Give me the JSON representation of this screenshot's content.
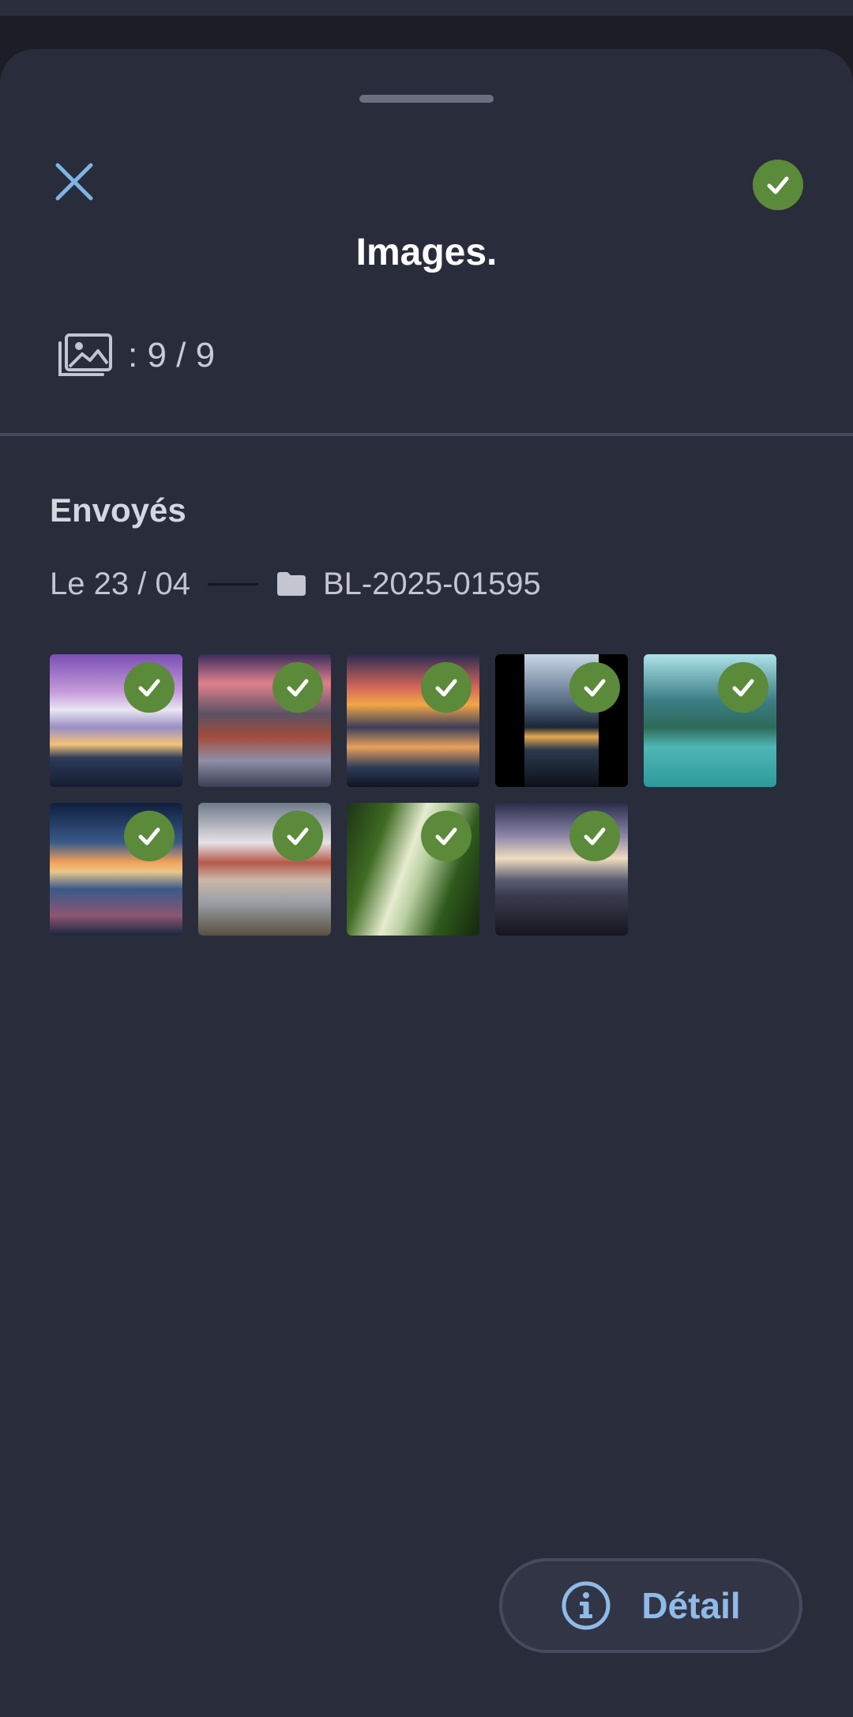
{
  "header": {
    "title": "Images.",
    "count": ": 9 / 9"
  },
  "section": {
    "title": "Envoyés",
    "date": "Le 23 / 04",
    "folder": "BL-2025-01595"
  },
  "images": [
    {
      "status": "sent"
    },
    {
      "status": "sent"
    },
    {
      "status": "sent"
    },
    {
      "status": "sent"
    },
    {
      "status": "sent"
    },
    {
      "status": "sent"
    },
    {
      "status": "sent"
    },
    {
      "status": "sent"
    },
    {
      "status": "sent"
    }
  ],
  "footer": {
    "detail_label": "Détail"
  },
  "colors": {
    "background": "#292c3b",
    "accent_blue": "#8fbbe8",
    "success_green": "#5b8a3a"
  },
  "icons": {
    "close": "close-icon",
    "status": "check-circle-icon",
    "gallery": "gallery-icon",
    "folder": "folder-icon",
    "info": "info-icon"
  }
}
